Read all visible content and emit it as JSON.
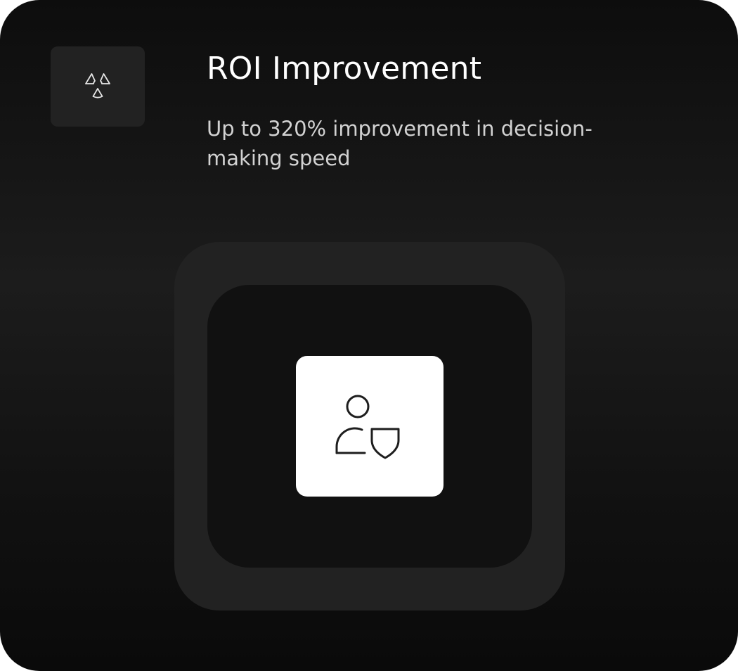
{
  "card": {
    "badge_icon": "radiation-icon",
    "title": "ROI Improvement",
    "description": "Up to 320% improvement in decision-making speed",
    "feature_icon": "user-shield-icon"
  },
  "colors": {
    "card_background": "#151515",
    "badge_background": "#222222",
    "outer_panel": "#222222",
    "inner_panel": "#111111",
    "icon_tile": "#ffffff",
    "title_text": "#ffffff",
    "description_text": "#d2d2d2"
  }
}
